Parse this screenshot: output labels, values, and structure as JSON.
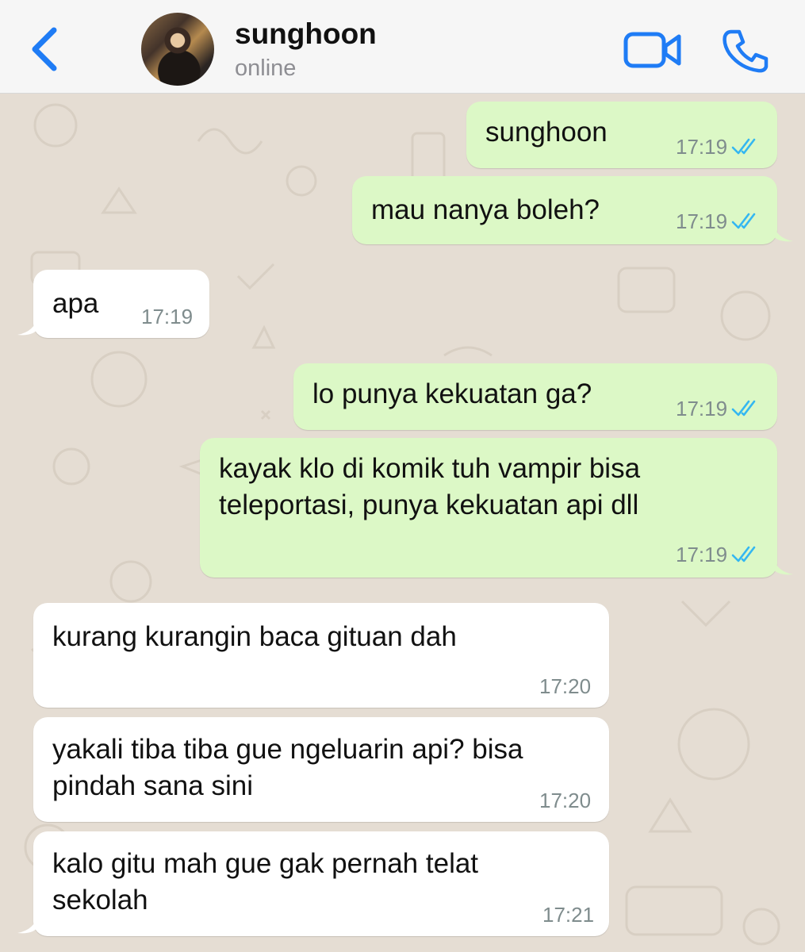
{
  "header": {
    "contact_name": "sunghoon",
    "status": "online",
    "accent_color": "#1f7cf5",
    "icons": [
      "chevron-left-icon",
      "video-camera-icon",
      "phone-icon"
    ]
  },
  "messages": [
    {
      "direction": "out",
      "text": "sunghoon",
      "time": "17:19",
      "read": true
    },
    {
      "direction": "out",
      "text": "mau nanya boleh?",
      "time": "17:19",
      "read": true
    },
    {
      "direction": "in",
      "text": "apa",
      "time": "17:19"
    },
    {
      "direction": "out",
      "text": "lo punya kekuatan ga?",
      "time": "17:19",
      "read": true
    },
    {
      "direction": "out",
      "text": "kayak klo di komik tuh vampir bisa\nteleportasi, punya kekuatan api dll",
      "time": "17:19",
      "read": true
    },
    {
      "direction": "in",
      "text": "kurang kurangin baca gituan dah",
      "time": "17:20"
    },
    {
      "direction": "in",
      "text": "yakali tiba tiba gue ngeluarin api? bisa\npindah sana sini",
      "time": "17:20"
    },
    {
      "direction": "in",
      "text": "kalo gitu mah gue gak pernah telat\nsekolah",
      "time": "17:21"
    }
  ],
  "colors": {
    "outgoing_bubble": "#dcf8c6",
    "incoming_bubble": "#ffffff",
    "read_ticks": "#34b7f1",
    "chat_background": "#e5ddd3"
  }
}
